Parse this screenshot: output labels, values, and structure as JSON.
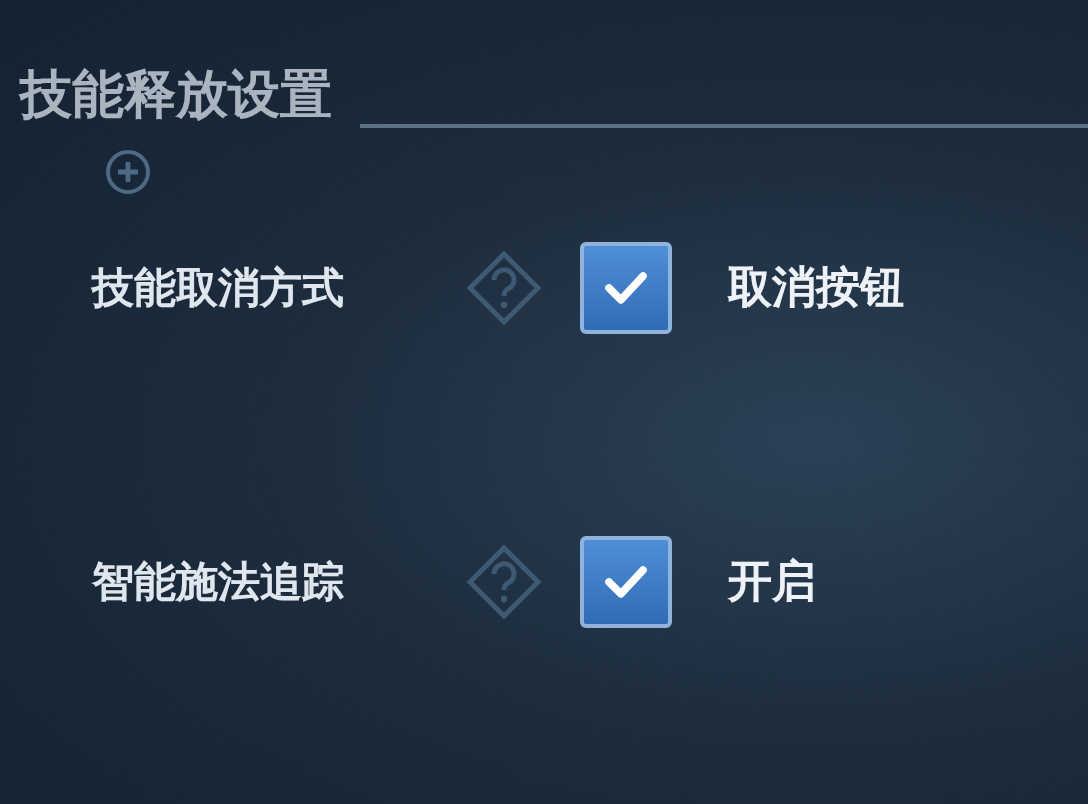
{
  "title": "技能释放设置",
  "settings": [
    {
      "label": "技能取消方式",
      "checked": true,
      "value": "取消按钮"
    },
    {
      "label": "智能施法追踪",
      "checked": true,
      "value": "开启"
    }
  ]
}
